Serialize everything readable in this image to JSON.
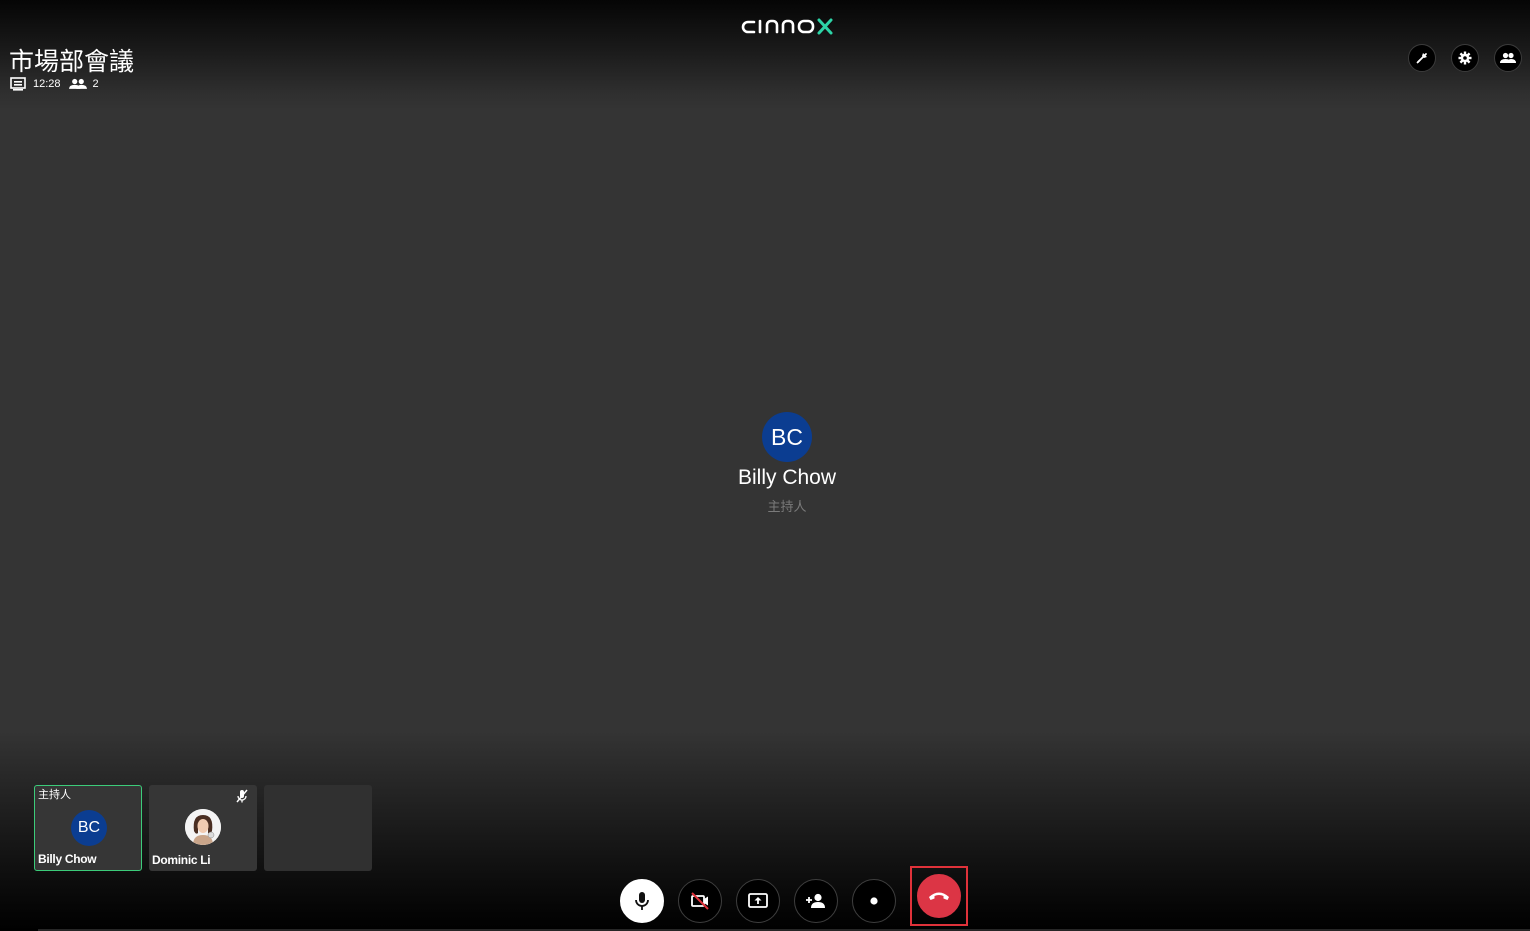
{
  "app": {
    "logo_text": "cinnox",
    "accent_color": "#2dd4a7",
    "hangup_color": "#dc3545",
    "avatar_color": "#0b3d91"
  },
  "meeting": {
    "title": "市場部會議",
    "duration": "12:28",
    "participant_count": "2"
  },
  "top_controls": [
    {
      "icon": "pin-icon"
    },
    {
      "icon": "gear-icon"
    },
    {
      "icon": "participants-icon"
    }
  ],
  "active_speaker": {
    "initials": "BC",
    "name": "Billy Chow",
    "role": "主持人"
  },
  "thumbnails": [
    {
      "role": "主持人",
      "initials": "BC",
      "name": "Billy Chow",
      "active": true
    },
    {
      "name": "Dominic Li",
      "muted": true,
      "photo": true
    },
    {
      "empty": true
    }
  ],
  "call_controls": [
    {
      "icon": "microphone-icon"
    },
    {
      "icon": "camera-off-icon"
    },
    {
      "icon": "screen-share-icon"
    },
    {
      "icon": "add-person-icon"
    },
    {
      "icon": "record-icon"
    },
    {
      "icon": "hang-up-icon"
    }
  ]
}
